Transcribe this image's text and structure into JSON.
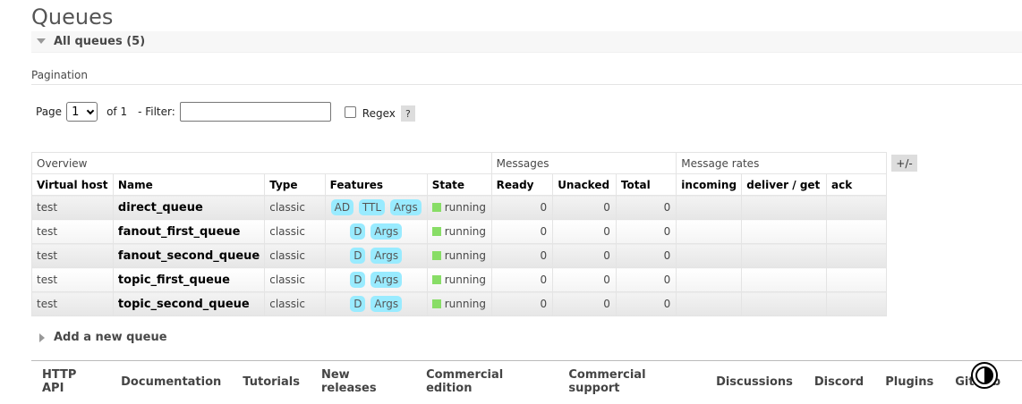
{
  "page": {
    "title": "Queues"
  },
  "section": {
    "label": "All queues (5)"
  },
  "pagination": {
    "label": "Pagination",
    "page_label": "Page",
    "page_value": "1",
    "of_label": "of 1",
    "filter_label": "- Filter:",
    "filter_value": "",
    "regex_label": "Regex",
    "help_label": "?"
  },
  "table": {
    "groups": [
      "Overview",
      "Messages",
      "Message rates"
    ],
    "columns": [
      "Virtual host",
      "Name",
      "Type",
      "Features",
      "State",
      "Ready",
      "Unacked",
      "Total",
      "incoming",
      "deliver / get",
      "ack"
    ],
    "toggle_label": "+/-",
    "rows": [
      {
        "vhost": "test",
        "name": "direct_queue",
        "type": "classic",
        "features": [
          "AD",
          "TTL",
          "Args"
        ],
        "state": "running",
        "ready": "0",
        "unacked": "0",
        "total": "0"
      },
      {
        "vhost": "test",
        "name": "fanout_first_queue",
        "type": "classic",
        "features": [
          "D",
          "Args"
        ],
        "state": "running",
        "ready": "0",
        "unacked": "0",
        "total": "0"
      },
      {
        "vhost": "test",
        "name": "fanout_second_queue",
        "type": "classic",
        "features": [
          "D",
          "Args"
        ],
        "state": "running",
        "ready": "0",
        "unacked": "0",
        "total": "0"
      },
      {
        "vhost": "test",
        "name": "topic_first_queue",
        "type": "classic",
        "features": [
          "D",
          "Args"
        ],
        "state": "running",
        "ready": "0",
        "unacked": "0",
        "total": "0"
      },
      {
        "vhost": "test",
        "name": "topic_second_queue",
        "type": "classic",
        "features": [
          "D",
          "Args"
        ],
        "state": "running",
        "ready": "0",
        "unacked": "0",
        "total": "0"
      }
    ]
  },
  "add_queue": {
    "label": "Add a new queue"
  },
  "footer": {
    "links": [
      "HTTP API",
      "Documentation",
      "Tutorials",
      "New releases",
      "Commercial edition",
      "Commercial support",
      "Discussions",
      "Discord",
      "Plugins",
      "GitHub"
    ]
  },
  "colors": {
    "badge": "#99ebff",
    "running": "#88dd66"
  },
  "icons": {
    "theme_toggle": "contrast-icon"
  }
}
